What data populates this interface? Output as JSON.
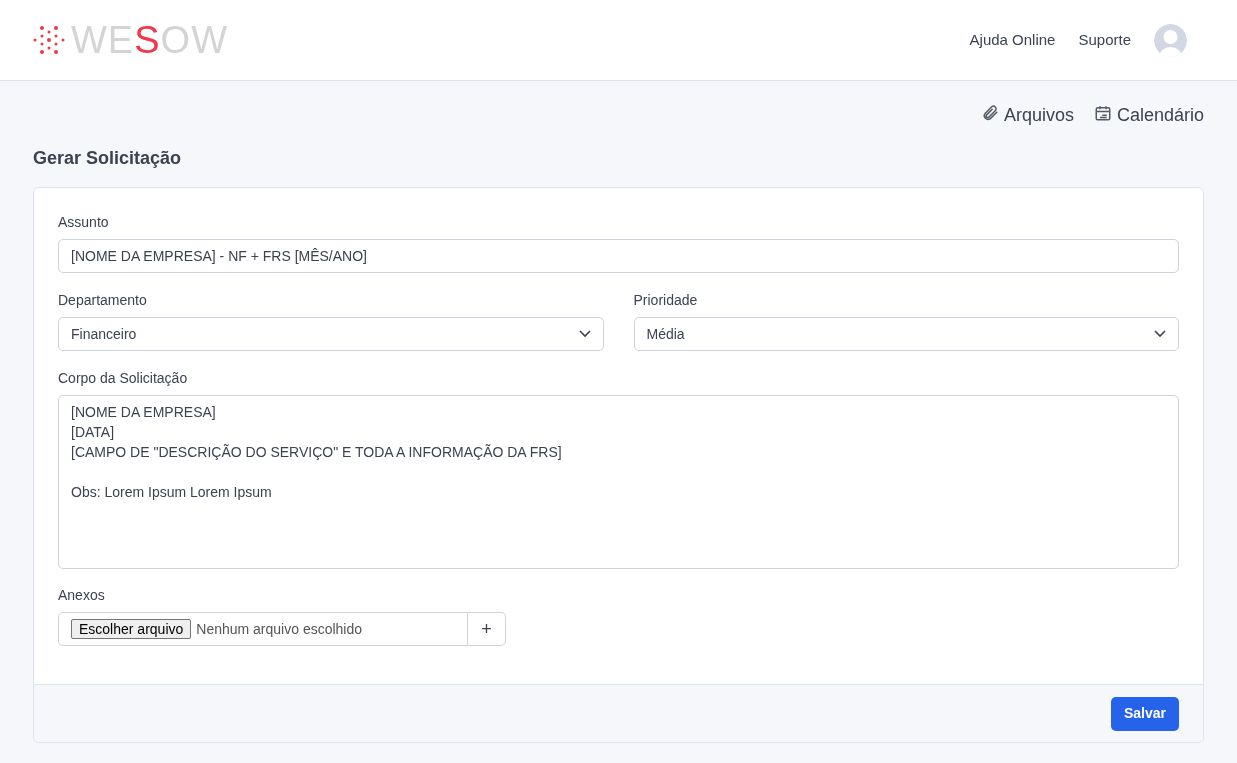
{
  "header": {
    "logo": {
      "before": "WE",
      "accent": "S",
      "after": "OW"
    },
    "links": [
      "Ajuda Online",
      "Suporte"
    ]
  },
  "toolbar": [
    {
      "kind": "clip",
      "label": "Arquivos"
    },
    {
      "kind": "calendar",
      "label": "Calendário"
    }
  ],
  "title": "Gerar Solicitação",
  "form": {
    "subject": {
      "label": "Assunto",
      "value": "[NOME DA EMPRESA] - NF + FRS [MÊS/ANO]"
    },
    "selects": [
      {
        "label": "Departamento",
        "value": "Financeiro"
      },
      {
        "label": "Prioridade",
        "value": "Média"
      }
    ],
    "body": {
      "label": "Corpo da Solicitação",
      "paragraphs": [
        [
          "[NOME DA EMPRESA]",
          "[DATA]",
          "[CAMPO DE \"DESCRIÇÃO DO SERVIÇO\" E TODA A INFORMAÇÃO DA FRS]"
        ],
        [
          "Obs: Lorem Ipsum Lorem Ipsum"
        ]
      ]
    },
    "attachments": {
      "label": "Anexos",
      "button": "Escolher arquivo",
      "status": "Nenhum arquivo escolhido",
      "add": "+"
    },
    "submit": "Salvar"
  }
}
